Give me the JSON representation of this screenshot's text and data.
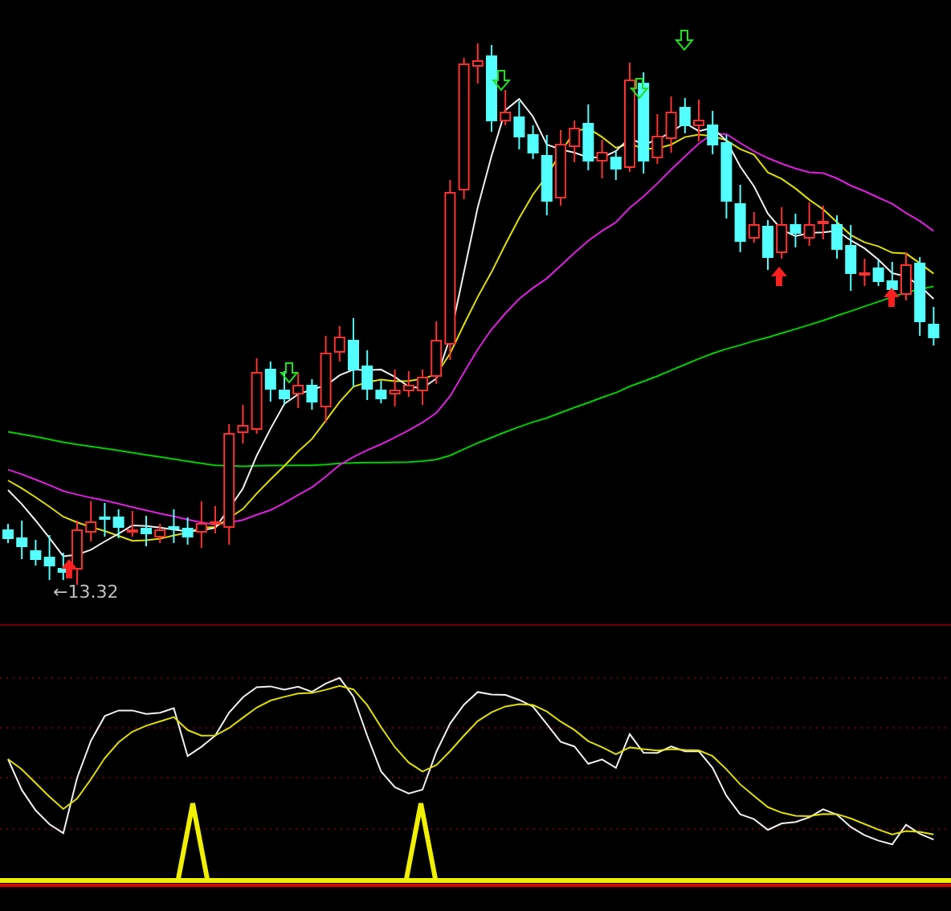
{
  "price_chart": {
    "low_label": "←13.32"
  }
}
